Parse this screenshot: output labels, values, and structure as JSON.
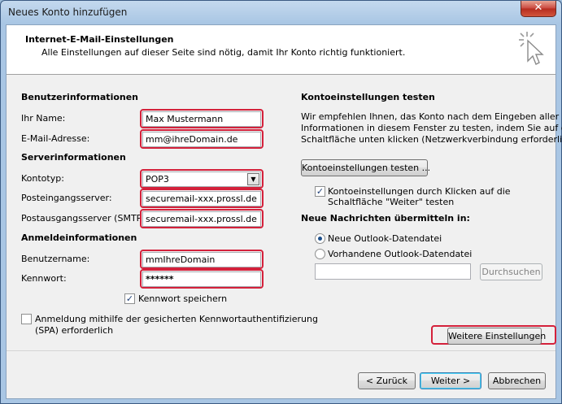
{
  "window": {
    "title": "Neues Konto hinzufügen",
    "close_glyph": "✕"
  },
  "header": {
    "title": "Internet-E-Mail-Einstellungen",
    "subtitle": "Alle Einstellungen auf dieser Seite sind nötig, damit Ihr Konto richtig funktioniert.",
    "icon": "cursor-click-icon"
  },
  "user_info": {
    "heading": "Benutzerinformationen",
    "name_label": "Ihr Name:",
    "name_value": "Max Mustermann",
    "email_label": "E-Mail-Adresse:",
    "email_value": "mm@ihreDomain.de"
  },
  "server_info": {
    "heading": "Serverinformationen",
    "account_type_label": "Kontotyp:",
    "account_type_value": "POP3",
    "incoming_label": "Posteingangsserver:",
    "incoming_value": "securemail-xxx.prossl.de",
    "outgoing_label": "Postausgangsserver (SMTP):",
    "outgoing_value": "securemail-xxx.prossl.de"
  },
  "login_info": {
    "heading": "Anmeldeinformationen",
    "username_label": "Benutzername:",
    "username_value": "mmIhreDomain",
    "password_label": "Kennwort:",
    "password_value": "******",
    "remember_label": "Kennwort speichern",
    "remember_checked": true,
    "spa_label_1": "Anmeldung mithilfe der gesicherten Kennwortauthentifizierung",
    "spa_label_2": "(SPA) erforderlich",
    "spa_checked": false
  },
  "test_settings": {
    "heading": "Kontoeinstellungen testen",
    "desc_1": "Wir empfehlen Ihnen, das Konto nach dem Eingeben aller",
    "desc_2": "Informationen in diesem Fenster zu testen, indem Sie auf die",
    "desc_3": "Schaltfläche unten klicken (Netzwerkverbindung erforderlich).",
    "test_button": "Kontoeinstellungen testen ...",
    "auto_test_label_1": "Kontoeinstellungen durch Klicken auf die",
    "auto_test_label_2": "Schaltfläche \"Weiter\" testen",
    "auto_test_checked": true
  },
  "deliver": {
    "heading": "Neue Nachrichten übermitteln in:",
    "option_new": "Neue Outlook-Datendatei",
    "option_existing": "Vorhandene Outlook-Datendatei",
    "selected": "option_new",
    "path_value": "",
    "browse_button": "Durchsuchen"
  },
  "more_settings_button": "Weitere Einstellungen",
  "footer": {
    "back_button": "< Zurück",
    "next_button": "Weiter >",
    "cancel_button": "Abbrechen"
  },
  "colors": {
    "highlight": "#d4213b",
    "title_bar": "#a9c6e4"
  }
}
